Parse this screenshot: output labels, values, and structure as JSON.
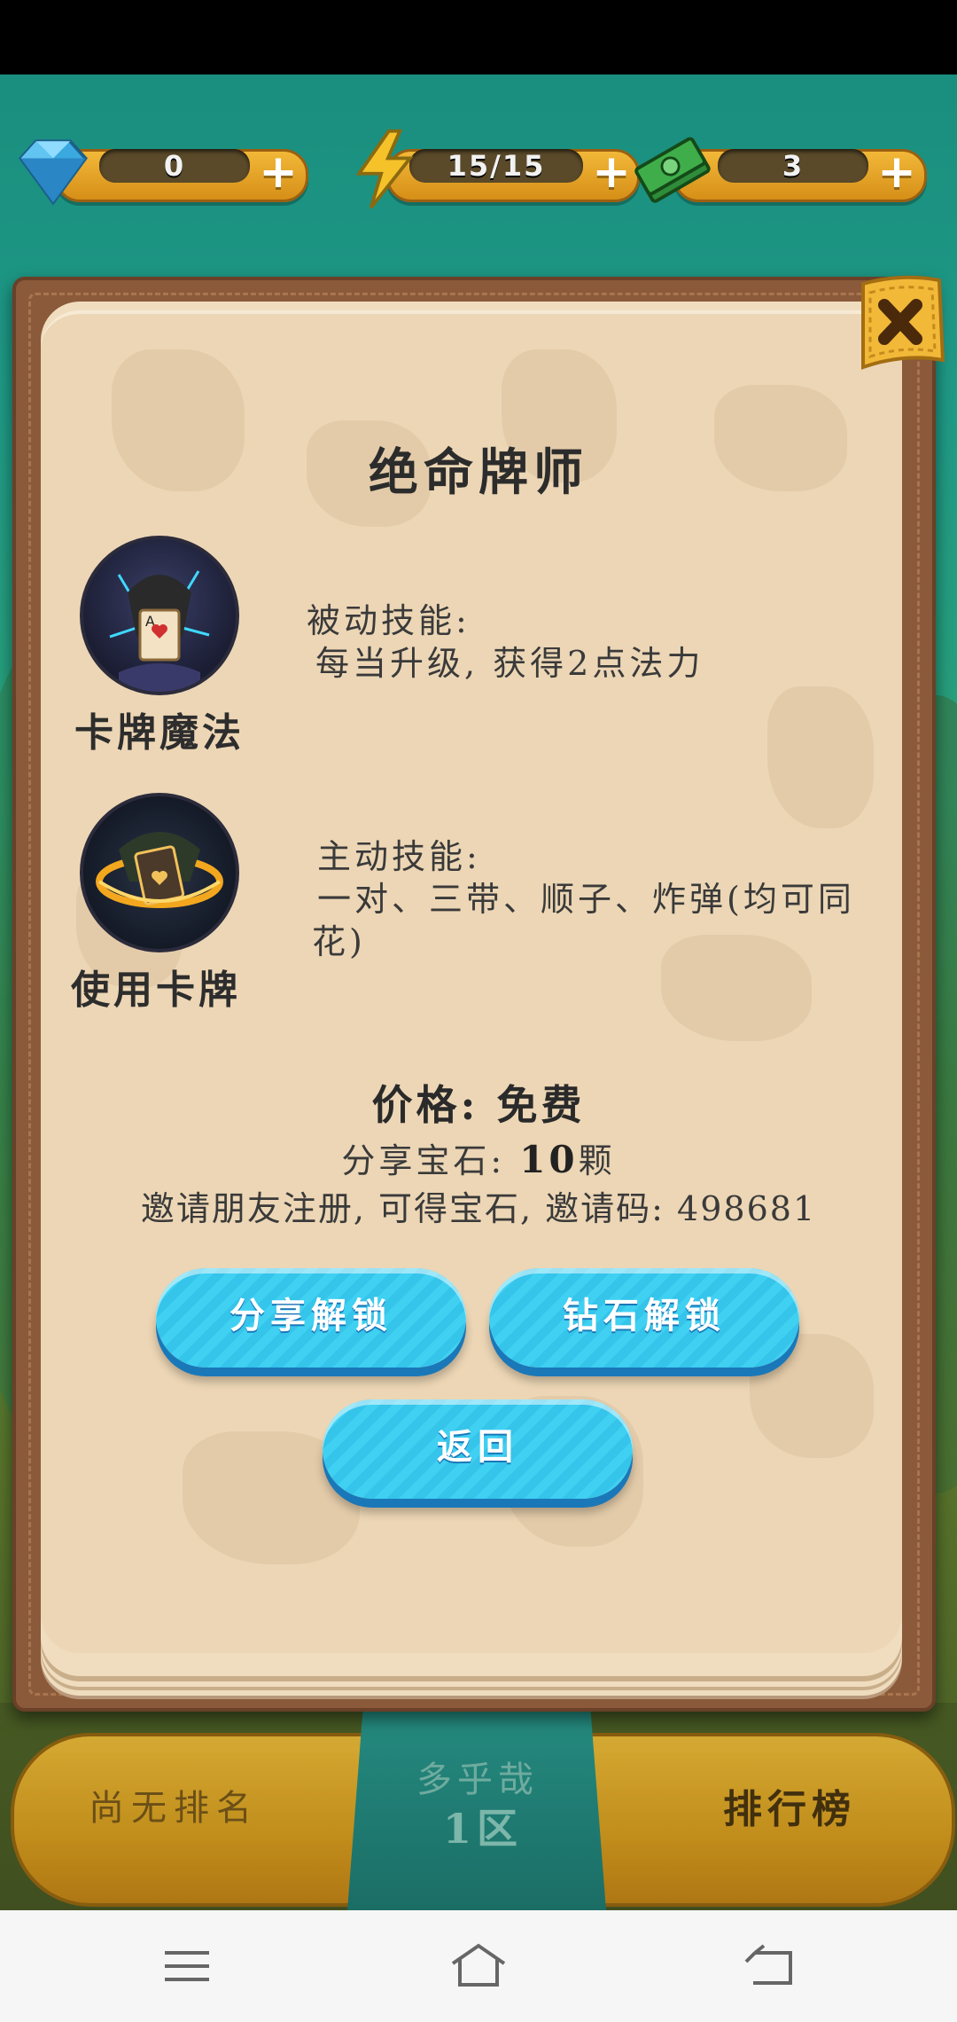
{
  "resources": {
    "gems": "0",
    "energy": "15/15",
    "cash": "3"
  },
  "dialog": {
    "title": "绝命牌师",
    "skills": [
      {
        "name": "卡牌魔法",
        "desc_line1": "被动技能:",
        "desc_line2": "每当升级, 获得2点法力",
        "desc_line3": ""
      },
      {
        "name": "使用卡牌",
        "desc_line1": "主动技能:",
        "desc_line2": "一对、三带、顺子、炸弹(均可同",
        "desc_line3": "花)"
      }
    ],
    "price": "价格: 免费",
    "share_prefix": "分享宝石: ",
    "share_count": "10",
    "share_suffix": "颗",
    "invite": "邀请朋友注册, 可得宝石, 邀请码: 498681",
    "buttons": {
      "share_unlock": "分享解锁",
      "gem_unlock": "钻石解锁",
      "back": "返回"
    }
  },
  "bottom_bar": {
    "rank": "尚无排名",
    "server_name": "多乎哉",
    "server_zone": "1区",
    "leaderboard": "排行榜"
  },
  "colors": {
    "button_blue": "#3fd0f2",
    "gold": "#f2c13a",
    "parchment": "#ecd6b5"
  },
  "icons": {
    "gem": "diamond-icon",
    "energy": "lightning-icon",
    "cash": "money-stack-icon",
    "close": "close-icon",
    "nav_menu": "menu-icon",
    "nav_home": "home-icon",
    "nav_back": "back-icon"
  }
}
